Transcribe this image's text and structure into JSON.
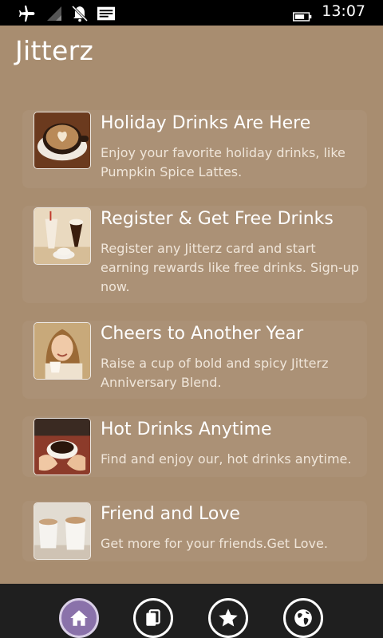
{
  "status_bar": {
    "time": "13:07",
    "icons": [
      "airplane-icon",
      "wifi-icon",
      "quiet-hours-bell-icon",
      "notification-center-icon",
      "battery-icon"
    ]
  },
  "app": {
    "title": "Jitterz"
  },
  "feed": {
    "items": [
      {
        "title": "Holiday Drinks Are Here",
        "description": "Enjoy your favorite holiday drinks, like Pumpkin Spice Lattes.",
        "image": "latte-art-thumbnail"
      },
      {
        "title": "Register & Get Free Drinks",
        "description": "Register any Jitterz card and start earning rewards like free drinks. Sign-up now.",
        "image": "milkshake-drinks-thumbnail"
      },
      {
        "title": "Cheers to Another Year",
        "description": "Raise a cup of bold and spicy Jitterz Anniversary Blend.",
        "image": "woman-with-cup-thumbnail"
      },
      {
        "title": "Hot Drinks Anytime",
        "description": "Find and enjoy our, hot drinks anytime.",
        "image": "hands-holding-coffee-thumbnail"
      },
      {
        "title": "Friend and Love",
        "description": "Get more for your friends.Get Love.",
        "image": "two-cappuccinos-thumbnail"
      }
    ]
  },
  "app_bar": {
    "buttons": [
      {
        "icon": "home-icon",
        "active": true
      },
      {
        "icon": "cards-icon",
        "active": false
      },
      {
        "icon": "star-icon",
        "active": false
      },
      {
        "icon": "globe-icon",
        "active": false
      }
    ]
  },
  "colors": {
    "background": "#a88d70",
    "app_bar": "#1f1f1f",
    "accent_active": "#8a72aa",
    "status_bar": "#000000"
  }
}
